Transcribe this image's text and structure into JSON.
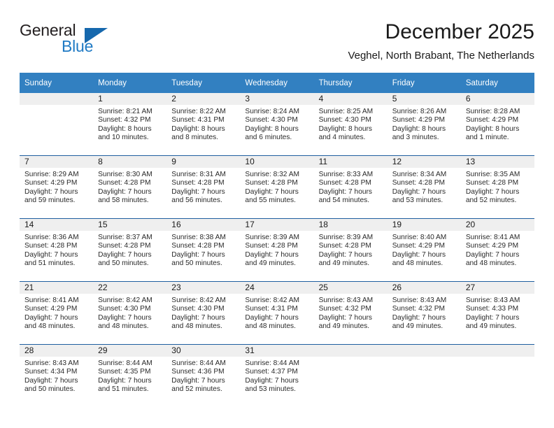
{
  "brand": {
    "name_top": "General",
    "name_bottom": "Blue",
    "triangle_color": "#1668ad",
    "blue_text_color": "#1f7ac4"
  },
  "header": {
    "title": "December 2025",
    "subtitle": "Veghel, North Brabant, The Netherlands",
    "header_bg": "#3280c1",
    "row_divider": "#1f5fa0",
    "daynum_band_bg": "#efefef"
  },
  "weekday_headers": [
    "Sunday",
    "Monday",
    "Tuesday",
    "Wednesday",
    "Thursday",
    "Friday",
    "Saturday"
  ],
  "weeks": [
    [
      {
        "day": "",
        "sunrise": "",
        "sunset": "",
        "daylight_line1": "",
        "daylight_line2": ""
      },
      {
        "day": "1",
        "sunrise": "Sunrise: 8:21 AM",
        "sunset": "Sunset: 4:32 PM",
        "daylight_line1": "Daylight: 8 hours",
        "daylight_line2": "and 10 minutes."
      },
      {
        "day": "2",
        "sunrise": "Sunrise: 8:22 AM",
        "sunset": "Sunset: 4:31 PM",
        "daylight_line1": "Daylight: 8 hours",
        "daylight_line2": "and 8 minutes."
      },
      {
        "day": "3",
        "sunrise": "Sunrise: 8:24 AM",
        "sunset": "Sunset: 4:30 PM",
        "daylight_line1": "Daylight: 8 hours",
        "daylight_line2": "and 6 minutes."
      },
      {
        "day": "4",
        "sunrise": "Sunrise: 8:25 AM",
        "sunset": "Sunset: 4:30 PM",
        "daylight_line1": "Daylight: 8 hours",
        "daylight_line2": "and 4 minutes."
      },
      {
        "day": "5",
        "sunrise": "Sunrise: 8:26 AM",
        "sunset": "Sunset: 4:29 PM",
        "daylight_line1": "Daylight: 8 hours",
        "daylight_line2": "and 3 minutes."
      },
      {
        "day": "6",
        "sunrise": "Sunrise: 8:28 AM",
        "sunset": "Sunset: 4:29 PM",
        "daylight_line1": "Daylight: 8 hours",
        "daylight_line2": "and 1 minute."
      }
    ],
    [
      {
        "day": "7",
        "sunrise": "Sunrise: 8:29 AM",
        "sunset": "Sunset: 4:29 PM",
        "daylight_line1": "Daylight: 7 hours",
        "daylight_line2": "and 59 minutes."
      },
      {
        "day": "8",
        "sunrise": "Sunrise: 8:30 AM",
        "sunset": "Sunset: 4:28 PM",
        "daylight_line1": "Daylight: 7 hours",
        "daylight_line2": "and 58 minutes."
      },
      {
        "day": "9",
        "sunrise": "Sunrise: 8:31 AM",
        "sunset": "Sunset: 4:28 PM",
        "daylight_line1": "Daylight: 7 hours",
        "daylight_line2": "and 56 minutes."
      },
      {
        "day": "10",
        "sunrise": "Sunrise: 8:32 AM",
        "sunset": "Sunset: 4:28 PM",
        "daylight_line1": "Daylight: 7 hours",
        "daylight_line2": "and 55 minutes."
      },
      {
        "day": "11",
        "sunrise": "Sunrise: 8:33 AM",
        "sunset": "Sunset: 4:28 PM",
        "daylight_line1": "Daylight: 7 hours",
        "daylight_line2": "and 54 minutes."
      },
      {
        "day": "12",
        "sunrise": "Sunrise: 8:34 AM",
        "sunset": "Sunset: 4:28 PM",
        "daylight_line1": "Daylight: 7 hours",
        "daylight_line2": "and 53 minutes."
      },
      {
        "day": "13",
        "sunrise": "Sunrise: 8:35 AM",
        "sunset": "Sunset: 4:28 PM",
        "daylight_line1": "Daylight: 7 hours",
        "daylight_line2": "and 52 minutes."
      }
    ],
    [
      {
        "day": "14",
        "sunrise": "Sunrise: 8:36 AM",
        "sunset": "Sunset: 4:28 PM",
        "daylight_line1": "Daylight: 7 hours",
        "daylight_line2": "and 51 minutes."
      },
      {
        "day": "15",
        "sunrise": "Sunrise: 8:37 AM",
        "sunset": "Sunset: 4:28 PM",
        "daylight_line1": "Daylight: 7 hours",
        "daylight_line2": "and 50 minutes."
      },
      {
        "day": "16",
        "sunrise": "Sunrise: 8:38 AM",
        "sunset": "Sunset: 4:28 PM",
        "daylight_line1": "Daylight: 7 hours",
        "daylight_line2": "and 50 minutes."
      },
      {
        "day": "17",
        "sunrise": "Sunrise: 8:39 AM",
        "sunset": "Sunset: 4:28 PM",
        "daylight_line1": "Daylight: 7 hours",
        "daylight_line2": "and 49 minutes."
      },
      {
        "day": "18",
        "sunrise": "Sunrise: 8:39 AM",
        "sunset": "Sunset: 4:28 PM",
        "daylight_line1": "Daylight: 7 hours",
        "daylight_line2": "and 49 minutes."
      },
      {
        "day": "19",
        "sunrise": "Sunrise: 8:40 AM",
        "sunset": "Sunset: 4:29 PM",
        "daylight_line1": "Daylight: 7 hours",
        "daylight_line2": "and 48 minutes."
      },
      {
        "day": "20",
        "sunrise": "Sunrise: 8:41 AM",
        "sunset": "Sunset: 4:29 PM",
        "daylight_line1": "Daylight: 7 hours",
        "daylight_line2": "and 48 minutes."
      }
    ],
    [
      {
        "day": "21",
        "sunrise": "Sunrise: 8:41 AM",
        "sunset": "Sunset: 4:29 PM",
        "daylight_line1": "Daylight: 7 hours",
        "daylight_line2": "and 48 minutes."
      },
      {
        "day": "22",
        "sunrise": "Sunrise: 8:42 AM",
        "sunset": "Sunset: 4:30 PM",
        "daylight_line1": "Daylight: 7 hours",
        "daylight_line2": "and 48 minutes."
      },
      {
        "day": "23",
        "sunrise": "Sunrise: 8:42 AM",
        "sunset": "Sunset: 4:30 PM",
        "daylight_line1": "Daylight: 7 hours",
        "daylight_line2": "and 48 minutes."
      },
      {
        "day": "24",
        "sunrise": "Sunrise: 8:42 AM",
        "sunset": "Sunset: 4:31 PM",
        "daylight_line1": "Daylight: 7 hours",
        "daylight_line2": "and 48 minutes."
      },
      {
        "day": "25",
        "sunrise": "Sunrise: 8:43 AM",
        "sunset": "Sunset: 4:32 PM",
        "daylight_line1": "Daylight: 7 hours",
        "daylight_line2": "and 49 minutes."
      },
      {
        "day": "26",
        "sunrise": "Sunrise: 8:43 AM",
        "sunset": "Sunset: 4:32 PM",
        "daylight_line1": "Daylight: 7 hours",
        "daylight_line2": "and 49 minutes."
      },
      {
        "day": "27",
        "sunrise": "Sunrise: 8:43 AM",
        "sunset": "Sunset: 4:33 PM",
        "daylight_line1": "Daylight: 7 hours",
        "daylight_line2": "and 49 minutes."
      }
    ],
    [
      {
        "day": "28",
        "sunrise": "Sunrise: 8:43 AM",
        "sunset": "Sunset: 4:34 PM",
        "daylight_line1": "Daylight: 7 hours",
        "daylight_line2": "and 50 minutes."
      },
      {
        "day": "29",
        "sunrise": "Sunrise: 8:44 AM",
        "sunset": "Sunset: 4:35 PM",
        "daylight_line1": "Daylight: 7 hours",
        "daylight_line2": "and 51 minutes."
      },
      {
        "day": "30",
        "sunrise": "Sunrise: 8:44 AM",
        "sunset": "Sunset: 4:36 PM",
        "daylight_line1": "Daylight: 7 hours",
        "daylight_line2": "and 52 minutes."
      },
      {
        "day": "31",
        "sunrise": "Sunrise: 8:44 AM",
        "sunset": "Sunset: 4:37 PM",
        "daylight_line1": "Daylight: 7 hours",
        "daylight_line2": "and 53 minutes."
      },
      {
        "day": "",
        "sunrise": "",
        "sunset": "",
        "daylight_line1": "",
        "daylight_line2": ""
      },
      {
        "day": "",
        "sunrise": "",
        "sunset": "",
        "daylight_line1": "",
        "daylight_line2": ""
      },
      {
        "day": "",
        "sunrise": "",
        "sunset": "",
        "daylight_line1": "",
        "daylight_line2": ""
      }
    ]
  ]
}
